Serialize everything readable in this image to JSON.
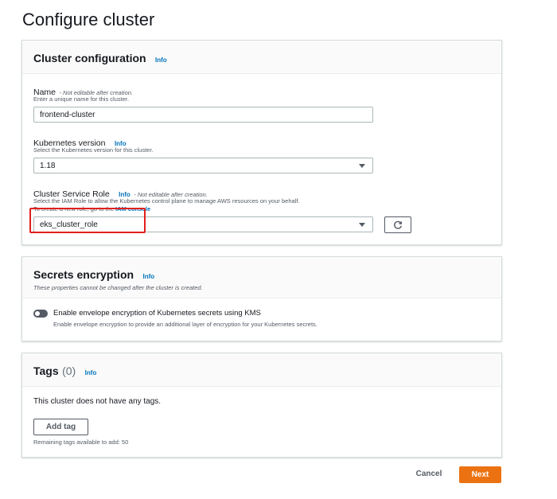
{
  "page": {
    "title": "Configure cluster"
  },
  "cluster_config": {
    "title": "Cluster configuration",
    "info": "Info",
    "name": {
      "label": "Name",
      "note": "- Not editable after creation.",
      "description": "Enter a unique name for this cluster.",
      "value": "frontend-cluster"
    },
    "version": {
      "label": "Kubernetes version",
      "info": "Info",
      "description": "Select the Kubernetes version for this cluster.",
      "value": "1.18"
    },
    "role": {
      "label": "Cluster Service Role",
      "info": "Info",
      "note": "- Not editable after creation.",
      "description": "Select the IAM Role to allow the Kubernetes control plane to manage AWS resources on your behalf.",
      "create_prefix": "To create a new role, go to the",
      "create_link": "IAM console",
      "value": "eks_cluster_role",
      "highlight_color": "#e0201c"
    }
  },
  "secrets": {
    "title": "Secrets encryption",
    "info": "Info",
    "subtitle": "These properties cannot be changed after the cluster is created.",
    "toggle_label": "Enable envelope encryption of Kubernetes secrets using KMS",
    "toggle_description": "Enable envelope encryption to provide an additional layer of encryption for your Kubernetes secrets.",
    "toggle_enabled": false
  },
  "tags": {
    "title": "Tags",
    "count": "(0)",
    "info": "Info",
    "empty_text": "This cluster does not have any tags.",
    "add_button": "Add tag",
    "remaining": "Remaining tags available to add: 50"
  },
  "footer": {
    "cancel": "Cancel",
    "next": "Next"
  },
  "colors": {
    "accent_orange": "#ec7211",
    "link_blue": "#0073bb",
    "text": "#16191f",
    "muted": "#545b64"
  },
  "icons": {
    "refresh": "refresh-icon",
    "caret": "caret-down-icon"
  }
}
